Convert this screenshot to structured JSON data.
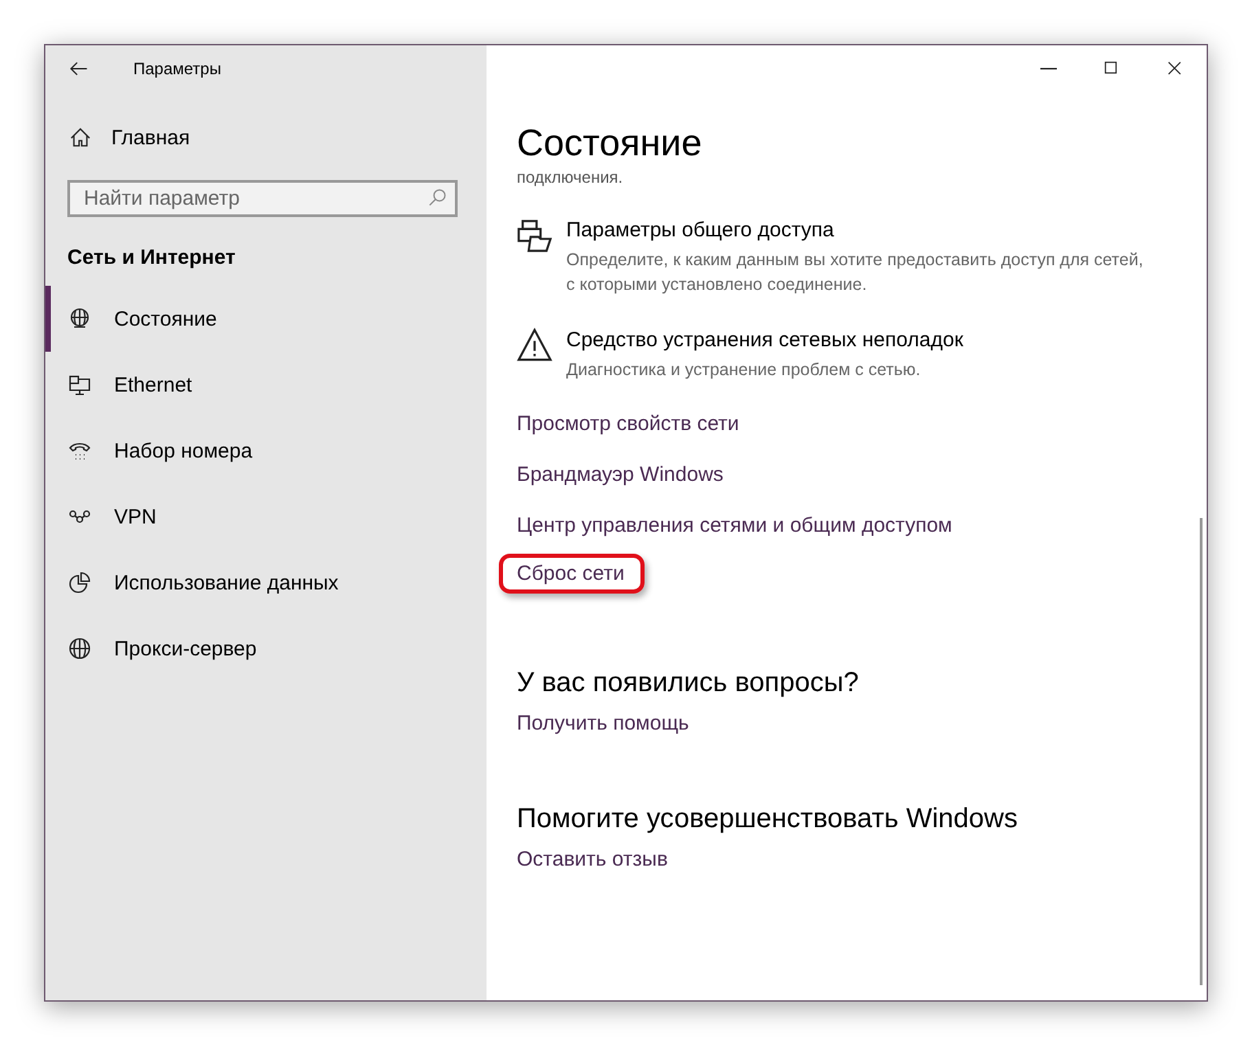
{
  "window": {
    "title": "Параметры"
  },
  "sidebar": {
    "home": "Главная",
    "search": {
      "placeholder": "Найти параметр"
    },
    "category": "Сеть и Интернет",
    "items": [
      {
        "label": "Состояние",
        "kind": "status",
        "selected": true
      },
      {
        "label": "Ethernet",
        "kind": "ethernet",
        "selected": false
      },
      {
        "label": "Набор номера",
        "kind": "dialup",
        "selected": false
      },
      {
        "label": "VPN",
        "kind": "vpn",
        "selected": false
      },
      {
        "label": "Использование данных",
        "kind": "data",
        "selected": false
      },
      {
        "label": "Прокси-сервер",
        "kind": "proxy",
        "selected": false
      }
    ]
  },
  "content": {
    "title": "Состояние",
    "cut_text": "подключения.",
    "settings": [
      {
        "kind": "sharing",
        "title": "Параметры общего доступа",
        "description": "Определите, к каким данным вы хотите предоставить доступ для сетей, с которыми установлено соединение."
      },
      {
        "kind": "warning",
        "title": "Средство устранения сетевых неполадок",
        "description": "Диагностика и устранение проблем с сетью."
      }
    ],
    "links": [
      {
        "label": "Просмотр свойств сети",
        "highlighted": false
      },
      {
        "label": "Брандмауэр Windows",
        "highlighted": false
      },
      {
        "label": "Центр управления сетями и общим доступом",
        "highlighted": false
      },
      {
        "label": "Сброс сети",
        "highlighted": true
      }
    ],
    "sections": [
      {
        "title": "У вас появились вопросы?",
        "link": "Получить помощь"
      },
      {
        "title": "Помогите усовершенствовать Windows",
        "link": "Оставить отзыв"
      }
    ]
  }
}
